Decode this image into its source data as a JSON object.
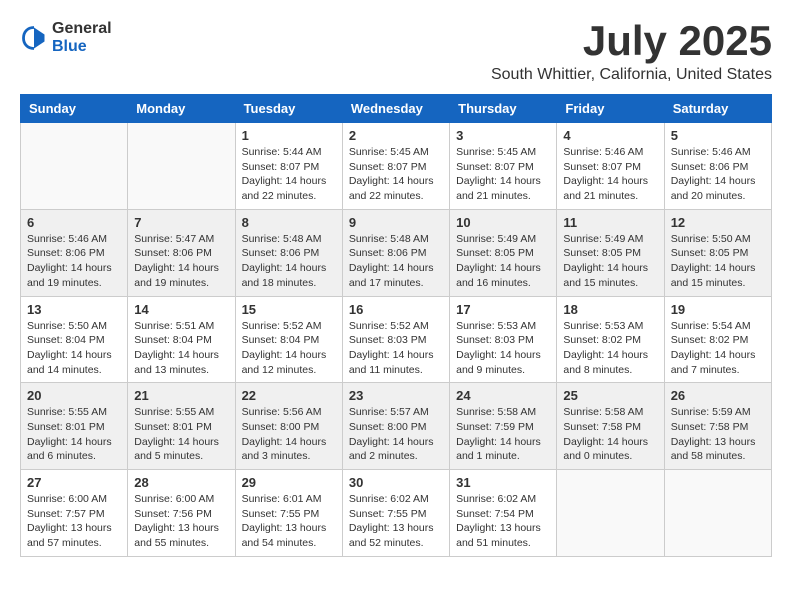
{
  "logo": {
    "general": "General",
    "blue": "Blue"
  },
  "title": "July 2025",
  "location": "South Whittier, California, United States",
  "days_of_week": [
    "Sunday",
    "Monday",
    "Tuesday",
    "Wednesday",
    "Thursday",
    "Friday",
    "Saturday"
  ],
  "weeks": [
    {
      "shaded": false,
      "days": [
        {
          "date": "",
          "info": ""
        },
        {
          "date": "",
          "info": ""
        },
        {
          "date": "1",
          "info": "Sunrise: 5:44 AM\nSunset: 8:07 PM\nDaylight: 14 hours\nand 22 minutes."
        },
        {
          "date": "2",
          "info": "Sunrise: 5:45 AM\nSunset: 8:07 PM\nDaylight: 14 hours\nand 22 minutes."
        },
        {
          "date": "3",
          "info": "Sunrise: 5:45 AM\nSunset: 8:07 PM\nDaylight: 14 hours\nand 21 minutes."
        },
        {
          "date": "4",
          "info": "Sunrise: 5:46 AM\nSunset: 8:07 PM\nDaylight: 14 hours\nand 21 minutes."
        },
        {
          "date": "5",
          "info": "Sunrise: 5:46 AM\nSunset: 8:06 PM\nDaylight: 14 hours\nand 20 minutes."
        }
      ]
    },
    {
      "shaded": true,
      "days": [
        {
          "date": "6",
          "info": "Sunrise: 5:46 AM\nSunset: 8:06 PM\nDaylight: 14 hours\nand 19 minutes."
        },
        {
          "date": "7",
          "info": "Sunrise: 5:47 AM\nSunset: 8:06 PM\nDaylight: 14 hours\nand 19 minutes."
        },
        {
          "date": "8",
          "info": "Sunrise: 5:48 AM\nSunset: 8:06 PM\nDaylight: 14 hours\nand 18 minutes."
        },
        {
          "date": "9",
          "info": "Sunrise: 5:48 AM\nSunset: 8:06 PM\nDaylight: 14 hours\nand 17 minutes."
        },
        {
          "date": "10",
          "info": "Sunrise: 5:49 AM\nSunset: 8:05 PM\nDaylight: 14 hours\nand 16 minutes."
        },
        {
          "date": "11",
          "info": "Sunrise: 5:49 AM\nSunset: 8:05 PM\nDaylight: 14 hours\nand 15 minutes."
        },
        {
          "date": "12",
          "info": "Sunrise: 5:50 AM\nSunset: 8:05 PM\nDaylight: 14 hours\nand 15 minutes."
        }
      ]
    },
    {
      "shaded": false,
      "days": [
        {
          "date": "13",
          "info": "Sunrise: 5:50 AM\nSunset: 8:04 PM\nDaylight: 14 hours\nand 14 minutes."
        },
        {
          "date": "14",
          "info": "Sunrise: 5:51 AM\nSunset: 8:04 PM\nDaylight: 14 hours\nand 13 minutes."
        },
        {
          "date": "15",
          "info": "Sunrise: 5:52 AM\nSunset: 8:04 PM\nDaylight: 14 hours\nand 12 minutes."
        },
        {
          "date": "16",
          "info": "Sunrise: 5:52 AM\nSunset: 8:03 PM\nDaylight: 14 hours\nand 11 minutes."
        },
        {
          "date": "17",
          "info": "Sunrise: 5:53 AM\nSunset: 8:03 PM\nDaylight: 14 hours\nand 9 minutes."
        },
        {
          "date": "18",
          "info": "Sunrise: 5:53 AM\nSunset: 8:02 PM\nDaylight: 14 hours\nand 8 minutes."
        },
        {
          "date": "19",
          "info": "Sunrise: 5:54 AM\nSunset: 8:02 PM\nDaylight: 14 hours\nand 7 minutes."
        }
      ]
    },
    {
      "shaded": true,
      "days": [
        {
          "date": "20",
          "info": "Sunrise: 5:55 AM\nSunset: 8:01 PM\nDaylight: 14 hours\nand 6 minutes."
        },
        {
          "date": "21",
          "info": "Sunrise: 5:55 AM\nSunset: 8:01 PM\nDaylight: 14 hours\nand 5 minutes."
        },
        {
          "date": "22",
          "info": "Sunrise: 5:56 AM\nSunset: 8:00 PM\nDaylight: 14 hours\nand 3 minutes."
        },
        {
          "date": "23",
          "info": "Sunrise: 5:57 AM\nSunset: 8:00 PM\nDaylight: 14 hours\nand 2 minutes."
        },
        {
          "date": "24",
          "info": "Sunrise: 5:58 AM\nSunset: 7:59 PM\nDaylight: 14 hours\nand 1 minute."
        },
        {
          "date": "25",
          "info": "Sunrise: 5:58 AM\nSunset: 7:58 PM\nDaylight: 14 hours\nand 0 minutes."
        },
        {
          "date": "26",
          "info": "Sunrise: 5:59 AM\nSunset: 7:58 PM\nDaylight: 13 hours\nand 58 minutes."
        }
      ]
    },
    {
      "shaded": false,
      "days": [
        {
          "date": "27",
          "info": "Sunrise: 6:00 AM\nSunset: 7:57 PM\nDaylight: 13 hours\nand 57 minutes."
        },
        {
          "date": "28",
          "info": "Sunrise: 6:00 AM\nSunset: 7:56 PM\nDaylight: 13 hours\nand 55 minutes."
        },
        {
          "date": "29",
          "info": "Sunrise: 6:01 AM\nSunset: 7:55 PM\nDaylight: 13 hours\nand 54 minutes."
        },
        {
          "date": "30",
          "info": "Sunrise: 6:02 AM\nSunset: 7:55 PM\nDaylight: 13 hours\nand 52 minutes."
        },
        {
          "date": "31",
          "info": "Sunrise: 6:02 AM\nSunset: 7:54 PM\nDaylight: 13 hours\nand 51 minutes."
        },
        {
          "date": "",
          "info": ""
        },
        {
          "date": "",
          "info": ""
        }
      ]
    }
  ]
}
